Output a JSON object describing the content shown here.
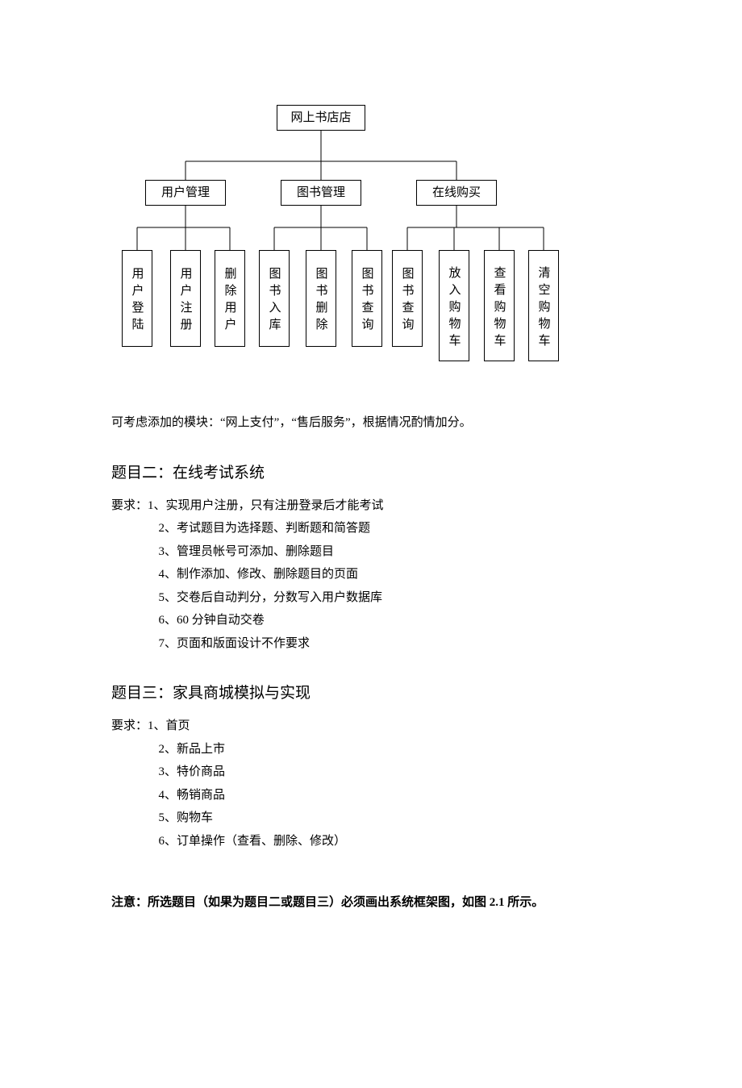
{
  "chart_data": {
    "type": "hierarchy",
    "root": "网上书店店",
    "children": [
      {
        "label": "用户管理",
        "children": [
          "用户登陆",
          "用户注册",
          "删除用户"
        ]
      },
      {
        "label": "图书管理",
        "children": [
          "图书入库",
          "图书删除",
          "图书查询"
        ]
      },
      {
        "label": "在线购买",
        "children": [
          "图书查询",
          "放入购物车",
          "查看购物车",
          "清空购物车"
        ]
      }
    ]
  },
  "module_note": "可考虑添加的模块：“网上支付”，“售后服务”，根据情况酌情加分。",
  "topic2": {
    "title": "题目二：在线考试系统",
    "req_lead": "要求：",
    "items": [
      "1、实现用户注册，只有注册登录后才能考试",
      "2、考试题目为选择题、判断题和简答题",
      "3、管理员帐号可添加、删除题目",
      "4、制作添加、修改、删除题目的页面",
      "5、交卷后自动判分，分数写入用户数据库",
      "6、60 分钟自动交卷",
      "7、页面和版面设计不作要求"
    ]
  },
  "topic3": {
    "title": "题目三：家具商城模拟与实现",
    "req_lead": "要求：",
    "items": [
      "1、首页",
      "2、新品上市",
      "3、特价商品",
      "4、畅销商品",
      "5、购物车",
      "6、订单操作（查看、删除、修改）"
    ]
  },
  "note": "注意：所选题目（如果为题目二或题目三）必须画出系统框架图，如图 2.1 所示。"
}
